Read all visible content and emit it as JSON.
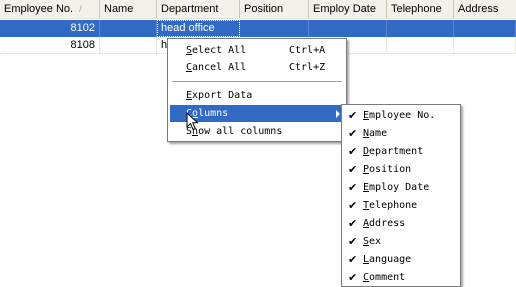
{
  "grid": {
    "columns": [
      {
        "label": "Employee No.",
        "sort": "/"
      },
      {
        "label": "Name"
      },
      {
        "label": "Department"
      },
      {
        "label": "Position"
      },
      {
        "label": "Employ Date"
      },
      {
        "label": "Telephone"
      },
      {
        "label": "Address"
      }
    ],
    "rows": [
      {
        "employee_no": "8102",
        "name": "",
        "department": "head office",
        "selected": true
      },
      {
        "employee_no": "8108",
        "name": "",
        "department": "h",
        "selected": false
      }
    ]
  },
  "context_menu": {
    "items": [
      {
        "key": "S",
        "rest": "elect All",
        "shortcut": "Ctrl+A"
      },
      {
        "key": "C",
        "rest": "ancel All",
        "shortcut": "Ctrl+Z"
      },
      {
        "key": "E",
        "rest": "xport Data"
      },
      {
        "prefix": "C",
        "key": "o",
        "rest": "lumns",
        "active": true,
        "submenu": true
      },
      {
        "prefix": "S",
        "key": "h",
        "rest": "ow all columns"
      }
    ]
  },
  "columns_submenu": {
    "items": [
      {
        "key": "E",
        "rest": "mployee No.",
        "checked": true
      },
      {
        "key": "N",
        "rest": "ame",
        "checked": true
      },
      {
        "key": "D",
        "rest": "epartment",
        "checked": true
      },
      {
        "key": "P",
        "rest": "osition",
        "checked": true
      },
      {
        "key": "E",
        "rest": "mploy Date",
        "checked": true
      },
      {
        "key": "T",
        "rest": "elephone",
        "checked": true
      },
      {
        "key": "A",
        "rest": "ddress",
        "checked": true
      },
      {
        "key": "S",
        "rest": "ex",
        "checked": true
      },
      {
        "key": "L",
        "rest": "anguage",
        "checked": true
      },
      {
        "key": "C",
        "rest": "omment",
        "checked": true
      }
    ]
  },
  "colors": {
    "selection": "#316ac5",
    "header_bg": "#f3f1ea"
  }
}
